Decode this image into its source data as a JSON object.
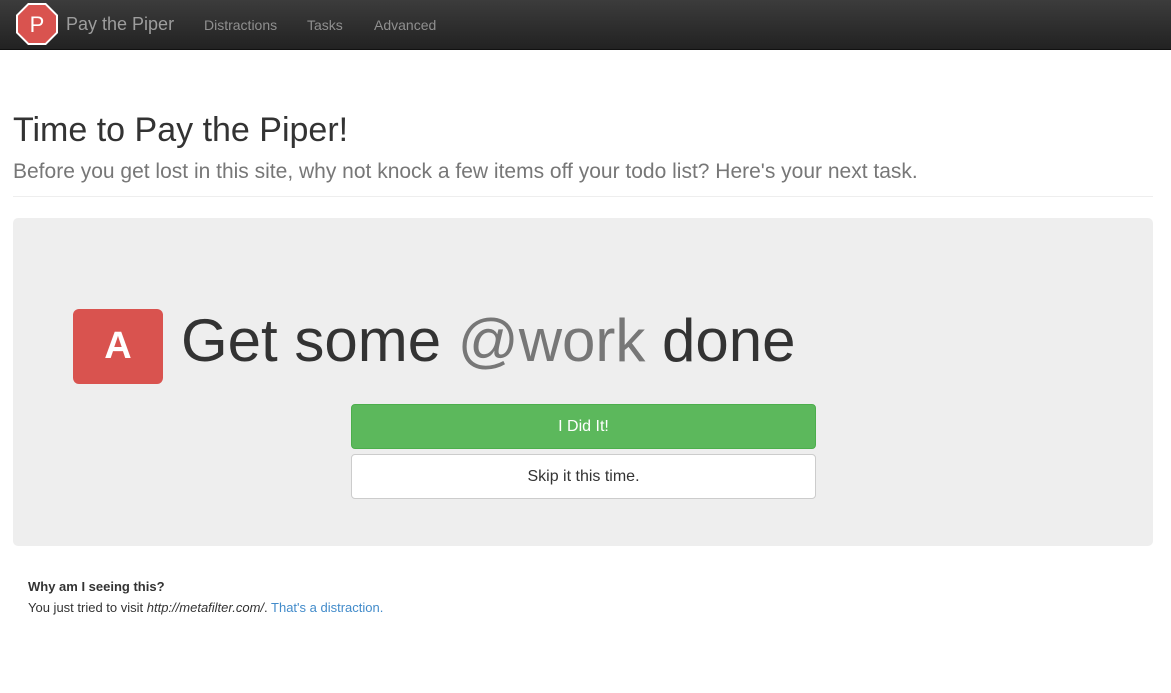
{
  "navbar": {
    "logo_letter": "P",
    "brand": "Pay the Piper",
    "items": [
      "Distractions",
      "Tasks",
      "Advanced"
    ],
    "logo_color": "#d9534f"
  },
  "header": {
    "title": "Time to Pay the Piper!",
    "subtitle": "Before you get lost in this site, why not knock a few items off your todo list? Here's your next task."
  },
  "task": {
    "priority": "A",
    "prefix": "Get some ",
    "context": "@work",
    "suffix": " done",
    "priority_color": "#d9534f",
    "done_label": "I Did It!",
    "skip_label": "Skip it this time."
  },
  "explanation": {
    "heading": "Why am I seeing this?",
    "text_before": "You just tried to visit ",
    "url": "http://metafilter.com/",
    "text_after": ". ",
    "link_text": "That's a distraction."
  }
}
